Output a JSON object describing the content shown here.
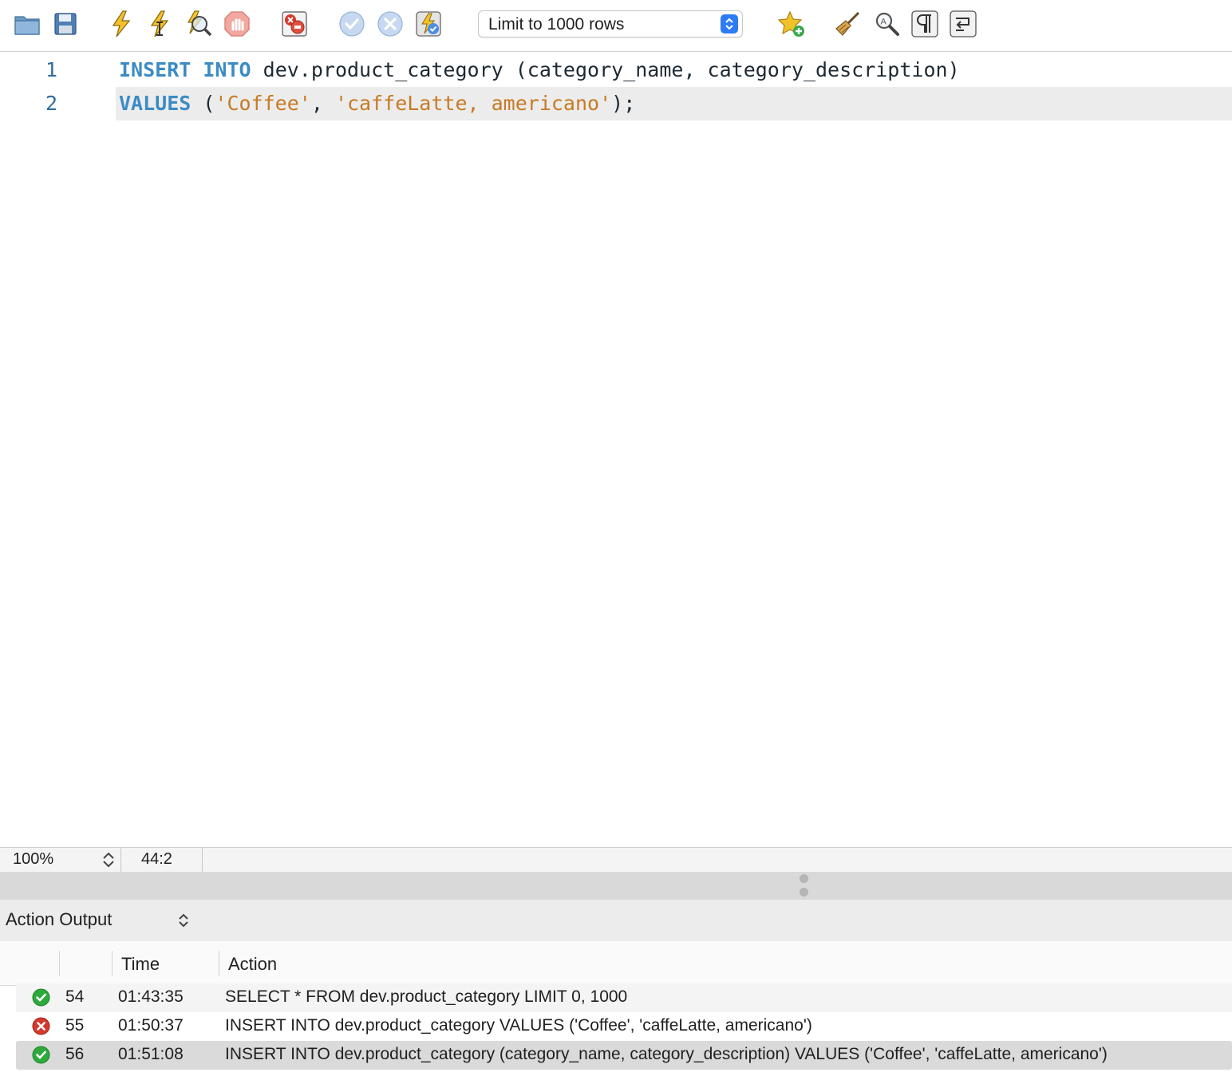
{
  "toolbar": {
    "icons": [
      {
        "name": "open-folder-icon"
      },
      {
        "name": "save-icon"
      },
      {
        "name": "execute-lightning-icon"
      },
      {
        "name": "execute-current-statement-icon"
      },
      {
        "name": "explain-magnifier-icon"
      },
      {
        "name": "stop-hand-icon"
      },
      {
        "name": "toggle-stop-on-error-icon"
      },
      {
        "name": "commit-check-icon"
      },
      {
        "name": "rollback-x-icon"
      },
      {
        "name": "autocommit-toggle-icon"
      },
      {
        "name": "add-snippet-star-icon"
      },
      {
        "name": "beautify-broom-icon"
      },
      {
        "name": "find-magnifier-icon"
      },
      {
        "name": "invisible-characters-pilcrow-icon"
      },
      {
        "name": "word-wrap-icon"
      }
    ],
    "limit_select": {
      "value": "Limit to 1000 rows"
    }
  },
  "editor": {
    "lines": [
      {
        "number": "1",
        "tokens": [
          {
            "t": "kw",
            "v": "INSERT"
          },
          {
            "t": "p",
            "v": " "
          },
          {
            "t": "kw",
            "v": "INTO"
          },
          {
            "t": "p",
            "v": " dev.product_category (category_name, category_description)"
          }
        ]
      },
      {
        "number": "2",
        "tokens": [
          {
            "t": "kw",
            "v": "VALUES"
          },
          {
            "t": "p",
            "v": " ("
          },
          {
            "t": "str",
            "v": "'Coffee'"
          },
          {
            "t": "p",
            "v": ", "
          },
          {
            "t": "str",
            "v": "'caffeLatte, americano'"
          },
          {
            "t": "p",
            "v": ");"
          }
        ]
      }
    ],
    "active_line": 2
  },
  "status_bar": {
    "zoom": "100%",
    "cursor_position": "44:2"
  },
  "output": {
    "title": "Action Output",
    "columns": {
      "blank": "",
      "time": "Time",
      "action": "Action"
    },
    "rows": [
      {
        "status": "success",
        "number": "54",
        "time": "01:43:35",
        "action": "SELECT * FROM dev.product_category LIMIT 0, 1000"
      },
      {
        "status": "error",
        "number": "55",
        "time": "01:50:37",
        "action": "INSERT INTO dev.product_category VALUES ('Coffee', 'caffeLatte, americano')"
      },
      {
        "status": "success",
        "number": "56",
        "time": "01:51:08",
        "action": "INSERT INTO dev.product_category (category_name, category_description) VALUES ('Coffee', 'caffeLatte, americano')"
      }
    ]
  },
  "colors": {
    "keyword": "#3b8bc4",
    "string": "#c77a23",
    "success": "#2eaa3c",
    "error": "#d33a2c",
    "select_accent": "#2d7cf6"
  }
}
